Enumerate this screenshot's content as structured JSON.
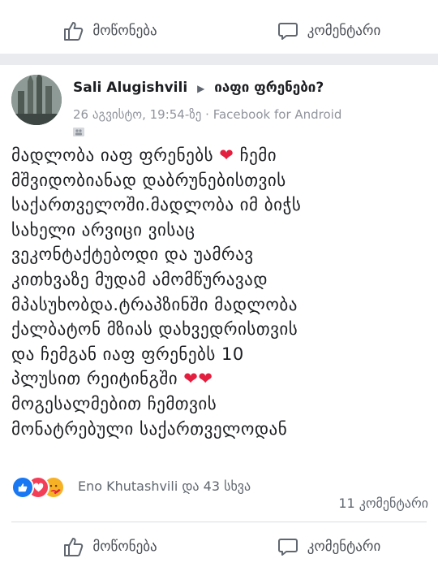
{
  "top_bar": {
    "like_label": "მოწონება",
    "comment_label": "კომენტარი"
  },
  "post": {
    "author": "Sali Alugishvili",
    "destination": "იაფი ფრენები?",
    "timestamp": "26 აგვისტო, 19:54-ზე",
    "separator": "·",
    "source": "Facebook for Android",
    "text_lines": [
      "მადლობა იაფ ფრენებს",
      "მშვიდობიანად დაბრუნებისთვის",
      "საქართველოში.მადლობა იმ ბიჭს",
      "სახელი არვიცი ვისაც",
      "ვეკონტაქტებოდი და უამრავ",
      "კითხვაზე მუდამ ამომწურავად",
      "მპასუხობდა.ტრაპზინში მადლობა",
      "ქალბატონ მზიას დახვედრისთვის",
      "და ჩემგან იაფ ფრენებს 10",
      "პლუსით რეიტინგში",
      "მოგესალმებით ჩემთვის",
      "მონატრებული საქართველოდან"
    ],
    "line1_tail": "ჩემი",
    "reactions_text": "Eno Khutashvili და 43 სხვა",
    "comments_count": "11 კომენტარი"
  },
  "bottom_bar": {
    "like_label": "მოწონება",
    "comment_label": "კომენტარი"
  },
  "colors": {
    "heart": "#e41e3f",
    "like_blue": "#1877f2",
    "separator_gray": "#e9ebee"
  }
}
